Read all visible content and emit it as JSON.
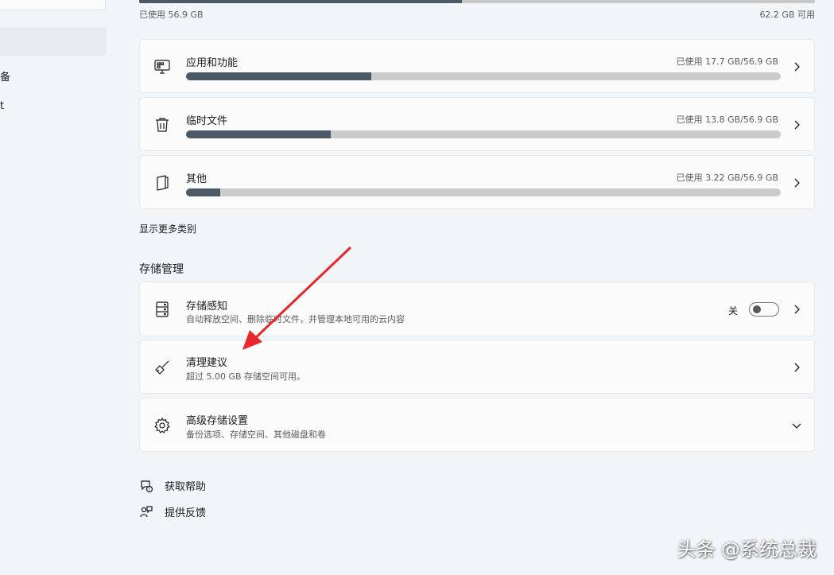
{
  "sidebar": {
    "items": [
      {
        "label": "备"
      },
      {
        "label": "t"
      }
    ]
  },
  "overview": {
    "used_label": "已使用 56.9 GB",
    "free_label": "62.2 GB 可用",
    "used_fraction": 0.478
  },
  "categories": [
    {
      "icon": "apps-icon",
      "title": "应用和功能",
      "usage": "已使用 17.7 GB/56.9 GB",
      "fraction": 0.311
    },
    {
      "icon": "trash-icon",
      "title": "临时文件",
      "usage": "已使用 13.8 GB/56.9 GB",
      "fraction": 0.243
    },
    {
      "icon": "document-icon",
      "title": "其他",
      "usage": "已使用 3.22 GB/56.9 GB",
      "fraction": 0.057
    }
  ],
  "show_more_label": "显示更多类别",
  "storage_management": {
    "heading": "存储管理",
    "storage_sense": {
      "title": "存储感知",
      "subtitle": "自动释放空间、删除临时文件，并管理本地可用的云内容",
      "toggle_state_label": "关",
      "toggle_on": false
    },
    "cleanup": {
      "title": "清理建议",
      "subtitle": "超过 5.00 GB 存储空间可用。"
    },
    "advanced": {
      "title": "高级存储设置",
      "subtitle": "备份选项、存储空间、其他磁盘和卷"
    }
  },
  "footer": {
    "help_label": "获取帮助",
    "feedback_label": "提供反馈"
  },
  "watermark": "头条 @系统总裁",
  "colors": {
    "bar_fill": "#4b5a66",
    "bar_track": "#cbcbcb",
    "annotation_arrow": "#e8262b"
  }
}
